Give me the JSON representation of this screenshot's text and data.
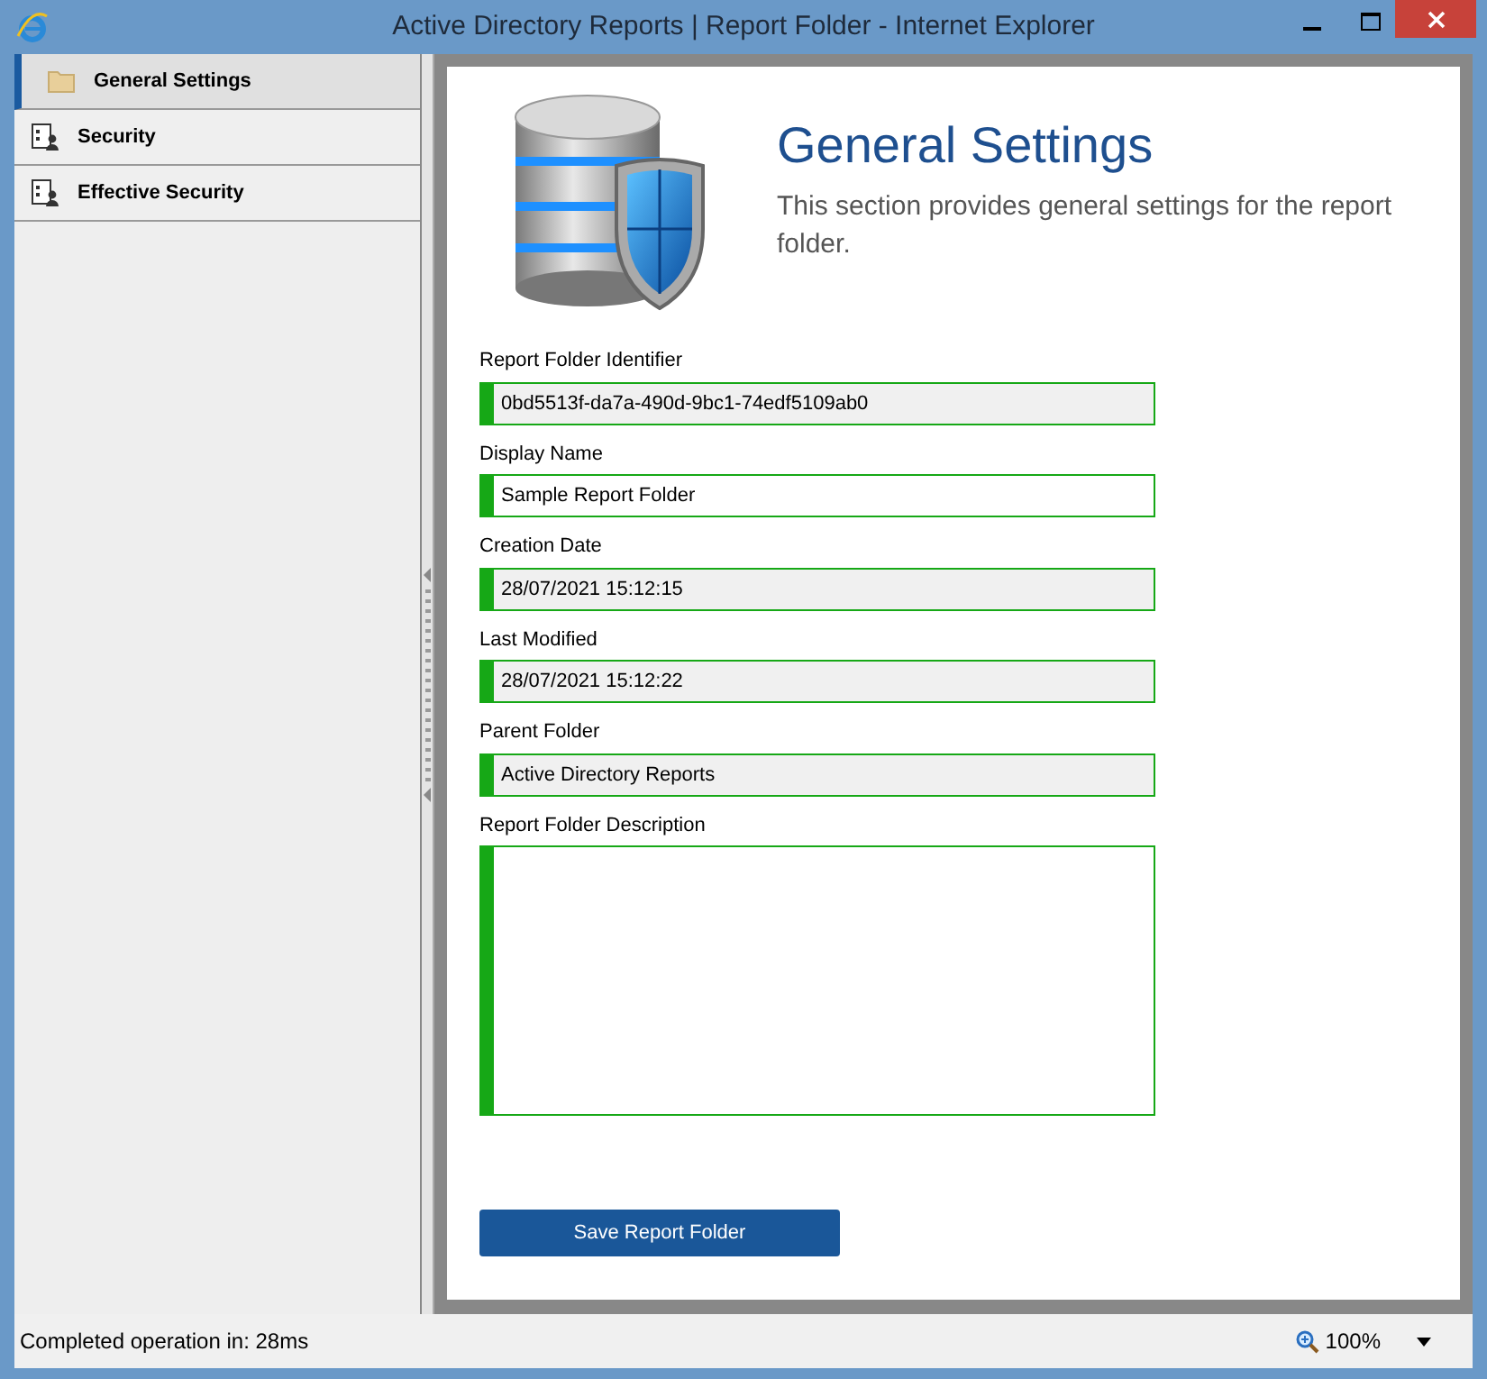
{
  "window": {
    "title": "Active Directory Reports | Report Folder - Internet Explorer"
  },
  "sidebar": {
    "items": [
      {
        "label": "General Settings",
        "kind": "folder",
        "selected": true
      },
      {
        "label": "Security",
        "kind": "security",
        "selected": false
      },
      {
        "label": "Effective Security",
        "kind": "security",
        "selected": false
      }
    ]
  },
  "header": {
    "title": "General Settings",
    "description": "This section provides general settings for the report folder."
  },
  "fields": [
    {
      "label": "Report Folder Identifier",
      "kind": "text",
      "value": "0bd5513f-da7a-490d-9bc1-74edf5109ab0",
      "editable": false
    },
    {
      "label": "Display Name",
      "kind": "text",
      "value": "Sample Report Folder",
      "editable": true
    },
    {
      "label": "Creation Date",
      "kind": "text",
      "value": "28/07/2021 15:12:15",
      "editable": false
    },
    {
      "label": "Last Modified",
      "kind": "text",
      "value": "28/07/2021 15:12:22",
      "editable": false
    },
    {
      "label": "Parent Folder",
      "kind": "text",
      "value": "Active Directory Reports",
      "editable": false
    },
    {
      "label": "Report Folder Description",
      "kind": "textarea",
      "editable": true
    }
  ],
  "save_button": "Save Report Folder",
  "status_bar": {
    "message": "Completed operation in: 28ms",
    "zoom": "100%"
  }
}
